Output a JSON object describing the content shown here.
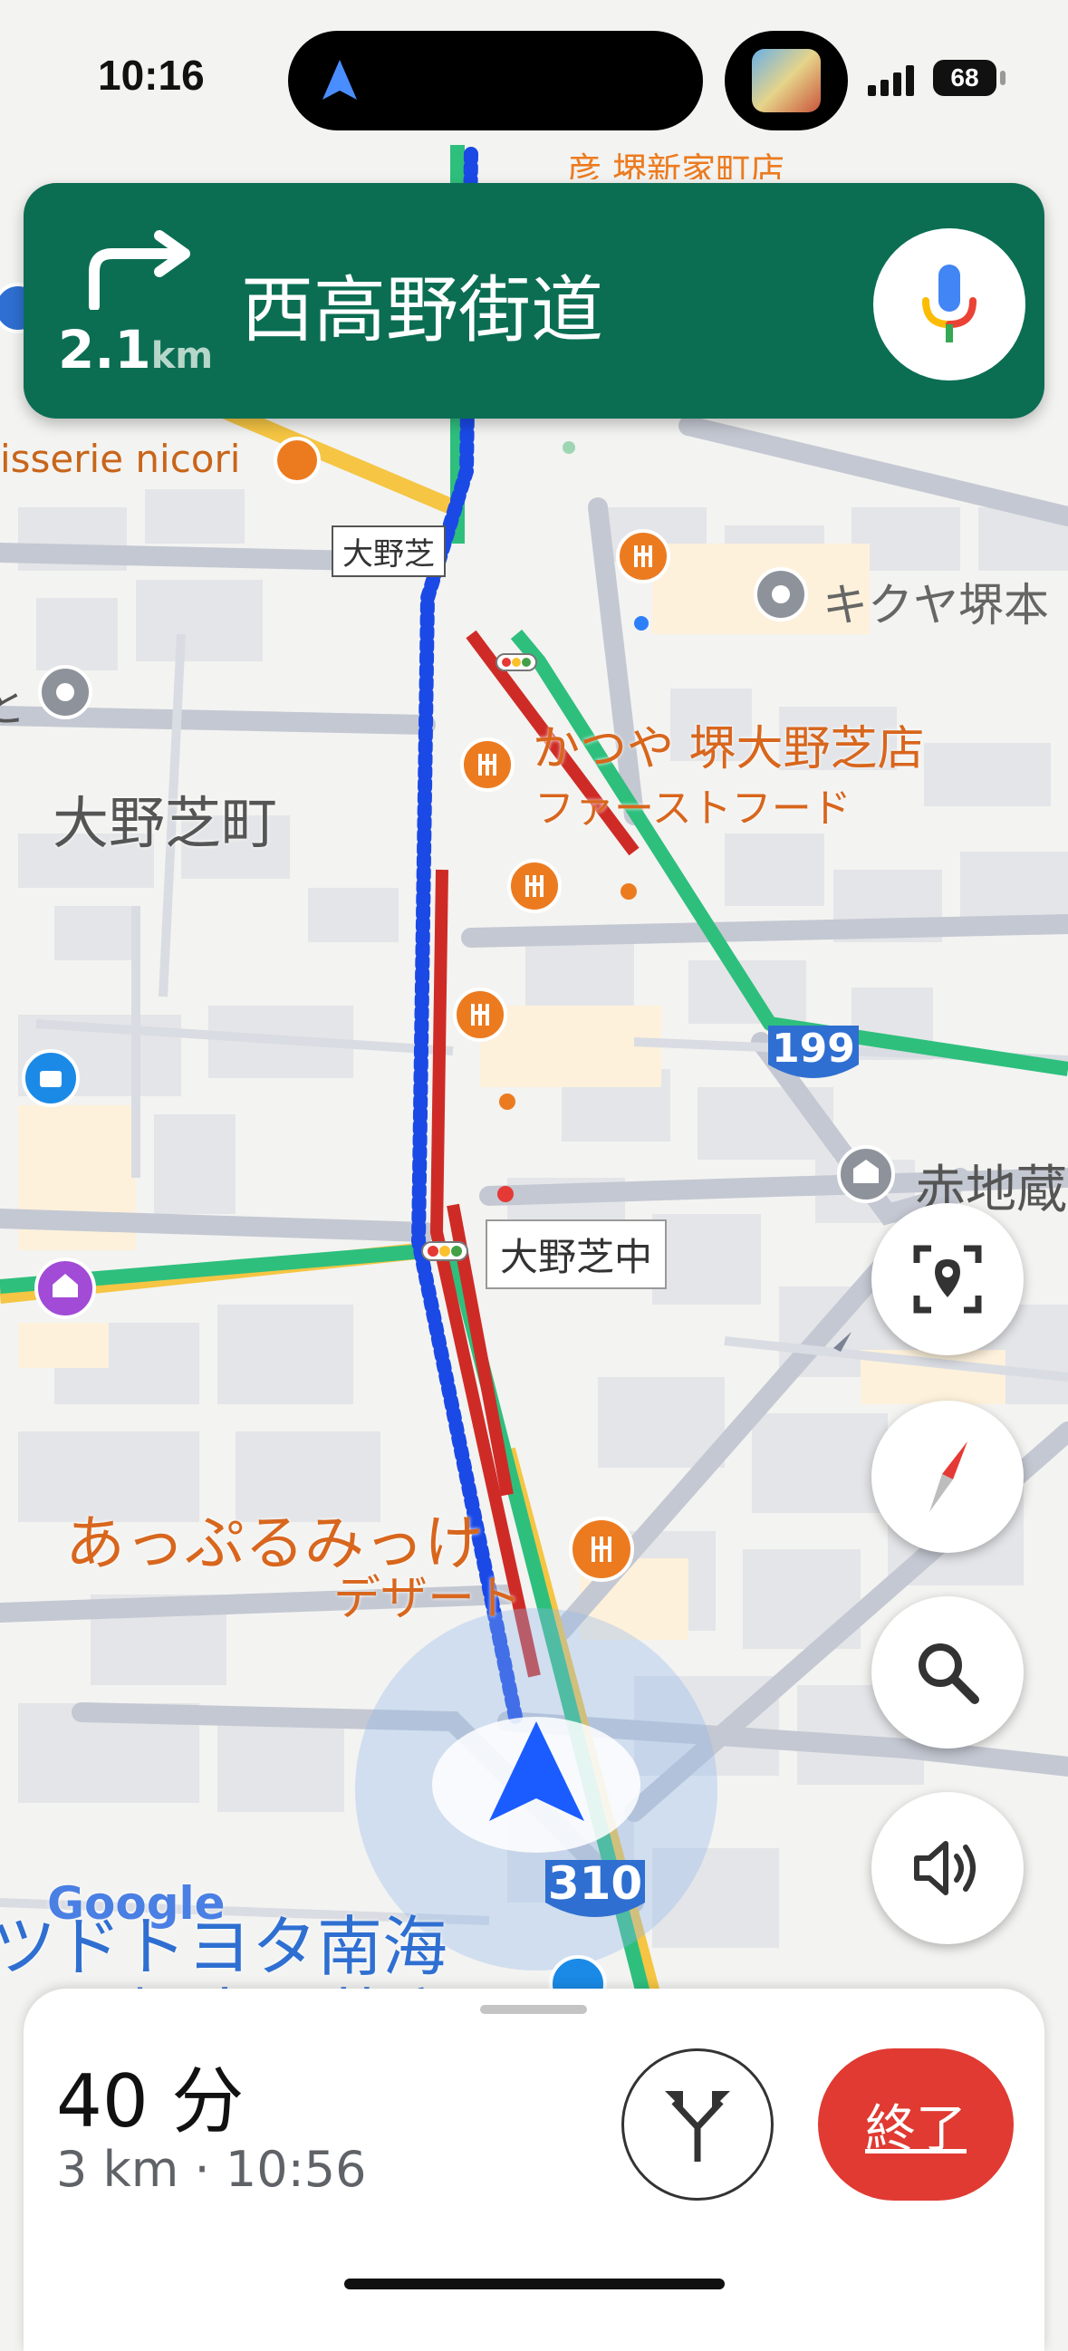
{
  "status_bar": {
    "time": "10:16",
    "battery": "68"
  },
  "instruction": {
    "distance_value": "2.1",
    "distance_unit": "km",
    "street": "西高野街道"
  },
  "map_labels": {
    "place_top_partial": "彦 堺新家町店",
    "place_patisserie": "isserie nicori",
    "station_onoshiba": "大野芝",
    "place_kikuya": "キクヤ堺本",
    "place_katsuya": "かつや 堺大野芝店",
    "category_fastfood": "ファーストフード",
    "area_onoshibacho": "大野芝町",
    "route_199": "199",
    "place_akaji": "赤地蔵",
    "intersection_onoshiba_naka": "大野芝中",
    "place_apple": "あっぷるみっけ",
    "category_dessert": "デザート",
    "route_310": "310",
    "place_toyota_partial": "ツドトヨタ南海",
    "place_toyota_line2": "堺大野芝店",
    "left_partial": "と",
    "google_logo": "Google"
  },
  "trip": {
    "duration": "40 分",
    "details": "3 km · 10:56",
    "end_label": "終了"
  },
  "colors": {
    "nav_green": "#0b6e53",
    "end_red": "#e03a32",
    "route_blue": "#1a49e6",
    "traffic_red": "#cf2b26",
    "traffic_green": "#2ebf7d",
    "poi_orange": "#ec7b20"
  }
}
